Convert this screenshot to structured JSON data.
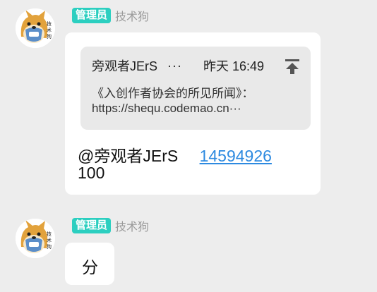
{
  "messages": [
    {
      "badge": "管理员",
      "sender": "技术狗",
      "avatar_icon": "shiba-dog-avatar-icon",
      "quote": {
        "author": "旁观者JErS",
        "ellipsis": "···",
        "time": "昨天 16:49",
        "line1": "《入创作者协会的所见所闻》：",
        "line2": "https://shequ.codemao.cn···",
        "pin_icon": "pin-to-top-icon"
      },
      "reply": {
        "mention": "@旁观者JErS",
        "link": "14594926",
        "line2": "100"
      }
    },
    {
      "badge": "管理员",
      "sender": "技术狗",
      "avatar_icon": "shiba-dog-avatar-icon",
      "text": "分"
    }
  ],
  "colors": {
    "background": "#ededed",
    "badge": "#2ccfc0",
    "link": "#2d8ae0",
    "quote_bg": "#e9e9e9"
  }
}
